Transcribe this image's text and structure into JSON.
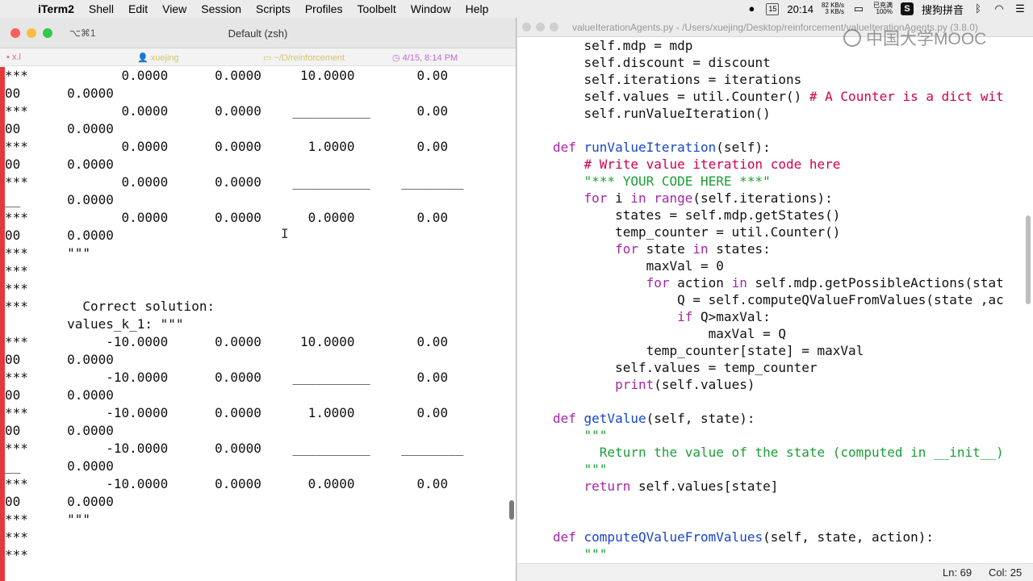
{
  "menubar": {
    "apple": "",
    "app": "iTerm2",
    "items": [
      "Shell",
      "Edit",
      "View",
      "Session",
      "Scripts",
      "Profiles",
      "Toolbelt",
      "Window",
      "Help"
    ],
    "calendar_day": "15",
    "clock": "20:14",
    "net_up": "82 KB/s",
    "net_down": "3 KB/s",
    "battery_status": "已充满",
    "battery_pct": "100%",
    "ime": "搜狗拼音"
  },
  "iterm": {
    "shortcut": "⌥⌘1",
    "title": "Default (zsh)",
    "status": {
      "host": "x.l",
      "user": "xuejing",
      "dir": "~/D/reinforcement",
      "datetime": "4/15, 8:14 PM"
    },
    "lines": [
      "***            0.0000      0.0000     10.0000        0.00",
      "00      0.0000",
      "***            0.0000      0.0000    __________      0.00",
      "00      0.0000",
      "***            0.0000      0.0000      1.0000        0.00",
      "00      0.0000",
      "***            0.0000      0.0000    __________    ________",
      "__      0.0000",
      "***            0.0000      0.0000      0.0000        0.00",
      "00      0.0000",
      "***     \"\"\"",
      "***",
      "***",
      "***       Correct solution:",
      "        values_k_1: \"\"\"",
      "***          -10.0000      0.0000     10.0000        0.00",
      "00      0.0000",
      "***          -10.0000      0.0000    __________      0.00",
      "00      0.0000",
      "***          -10.0000      0.0000      1.0000        0.00",
      "00      0.0000",
      "***          -10.0000      0.0000    __________    ________",
      "__      0.0000",
      "***          -10.0000      0.0000      0.0000        0.00",
      "00      0.0000",
      "***     \"\"\"",
      "***",
      "***"
    ]
  },
  "editor": {
    "file_title": "valueIterationAgents.py - /Users/xuejing/Desktop/reinforcement/valueIterationAgents.py (3.8.0)",
    "status_line": "Ln: 69",
    "status_col": "Col: 25",
    "lines": [
      [
        [
          "pl",
          "    self.mdp = mdp"
        ]
      ],
      [
        [
          "pl",
          "    self.discount = discount"
        ]
      ],
      [
        [
          "pl",
          "    self.iterations = iterations"
        ]
      ],
      [
        [
          "pl",
          "    self.values = util.Counter() "
        ],
        [
          "cm",
          "# A Counter is a dict wit"
        ]
      ],
      [
        [
          "pl",
          "    self.runValueIteration()"
        ]
      ],
      [
        [
          "pl",
          ""
        ]
      ],
      [
        [
          "kw",
          "def "
        ],
        [
          "fn",
          "runValueIteration"
        ],
        [
          "pl",
          "(self):"
        ]
      ],
      [
        [
          "cm",
          "    # Write value iteration code here"
        ]
      ],
      [
        [
          "st",
          "    \"*** YOUR CODE HERE ***\""
        ]
      ],
      [
        [
          "kw",
          "    for"
        ],
        [
          "pl",
          " i "
        ],
        [
          "kw",
          "in"
        ],
        [
          "pl",
          " "
        ],
        [
          "kw",
          "range"
        ],
        [
          "pl",
          "(self.iterations):"
        ]
      ],
      [
        [
          "pl",
          "        states = self.mdp.getStates()"
        ]
      ],
      [
        [
          "pl",
          "        temp_counter = util.Counter()"
        ]
      ],
      [
        [
          "kw",
          "        for"
        ],
        [
          "pl",
          " state "
        ],
        [
          "kw",
          "in"
        ],
        [
          "pl",
          " states:"
        ]
      ],
      [
        [
          "pl",
          "            maxVal = 0"
        ]
      ],
      [
        [
          "kw",
          "            for"
        ],
        [
          "pl",
          " action "
        ],
        [
          "kw",
          "in"
        ],
        [
          "pl",
          " self.mdp.getPossibleActions(stat"
        ]
      ],
      [
        [
          "pl",
          "                Q = self.computeQValueFromValues(state ,ac"
        ]
      ],
      [
        [
          "kw",
          "                if"
        ],
        [
          "pl",
          " Q>maxVal:"
        ]
      ],
      [
        [
          "pl",
          "                    maxVal = Q"
        ]
      ],
      [
        [
          "pl",
          "            temp_counter[state] = maxVal"
        ]
      ],
      [
        [
          "pl",
          "        self.values = temp_counter"
        ]
      ],
      [
        [
          "kw",
          "        print"
        ],
        [
          "pl",
          "(self.values)"
        ]
      ],
      [
        [
          "pl",
          ""
        ]
      ],
      [
        [
          "kw",
          "def "
        ],
        [
          "fn",
          "getValue"
        ],
        [
          "pl",
          "(self, state):"
        ]
      ],
      [
        [
          "st",
          "    \"\"\""
        ]
      ],
      [
        [
          "st",
          "      Return the value of the state (computed in __init__)"
        ]
      ],
      [
        [
          "st",
          "    \"\"\""
        ]
      ],
      [
        [
          "kw",
          "    return"
        ],
        [
          "pl",
          " self.values[state]"
        ]
      ],
      [
        [
          "pl",
          ""
        ]
      ],
      [
        [
          "pl",
          ""
        ]
      ],
      [
        [
          "kw",
          "def "
        ],
        [
          "fn",
          "computeQValueFromValues"
        ],
        [
          "pl",
          "(self, state, action):"
        ]
      ],
      [
        [
          "st",
          "    \"\"\""
        ]
      ]
    ]
  },
  "watermark": {
    "text": "中国大学MOOC"
  },
  "icons": [
    "apple-logo-icon",
    "calendar-icon",
    "wifi-icon",
    "bluetooth-icon",
    "ime-icon",
    "menu-list-icon",
    "text-cursor-icon"
  ]
}
